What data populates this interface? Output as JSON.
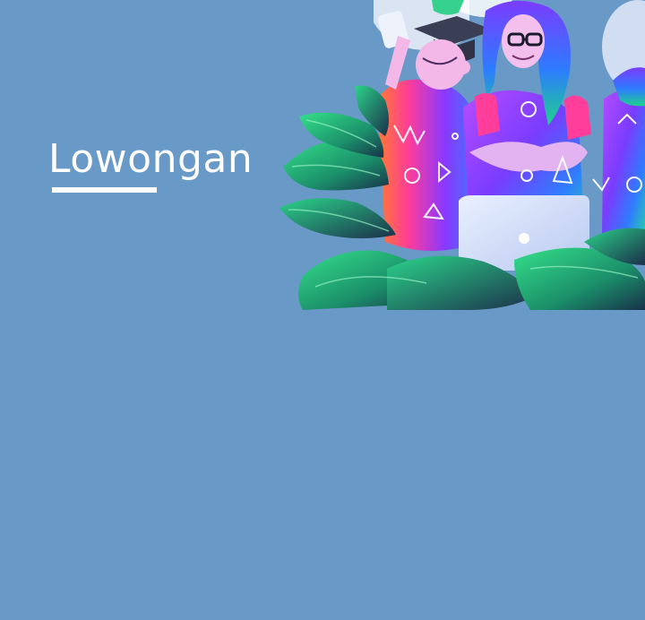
{
  "hero": {
    "title": "Lowongan"
  },
  "colors": {
    "background": "#6899c7",
    "title": "#ffffff"
  },
  "illustration": {
    "description_icons": [
      "students-group-illustration",
      "laptop-icon",
      "leaves-decoration"
    ]
  }
}
